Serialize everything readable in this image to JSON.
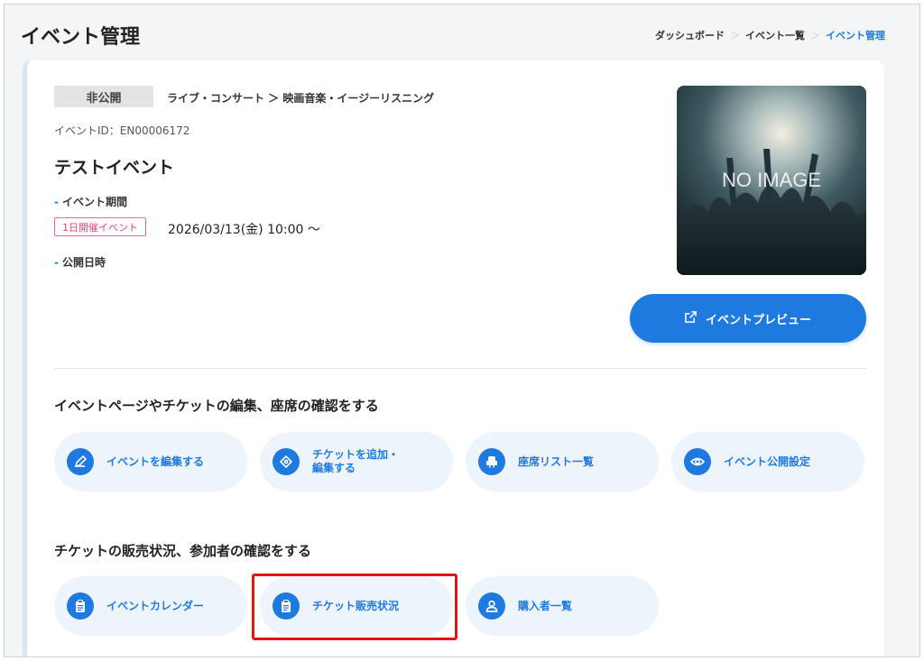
{
  "header": {
    "title": "イベント管理",
    "breadcrumb": [
      "ダッシュボード",
      "イベント一覧",
      "イベント管理"
    ]
  },
  "event": {
    "status": "非公開",
    "category": "ライブ・コンサート ＞ 映画音楽・イージーリスニング",
    "id_label": "イベントID：EN00006172",
    "name": "テストイベント",
    "period_label": "イベント期間",
    "one_day_tag": "1日開催イベント",
    "date": "2026/03/13(金) 10:00 ～",
    "publish_label": "公開日時",
    "image_text": "NO IMAGE"
  },
  "preview_button": {
    "label": "イベントプレビュー",
    "icon": "external-link-icon"
  },
  "section_edit": {
    "heading": "イベントページやチケットの編集、座席の確認をする",
    "actions": [
      {
        "label": "イベントを編集する",
        "icon": "pencil-icon"
      },
      {
        "label": "チケットを追加・\n編集する",
        "icon": "ticket-icon"
      },
      {
        "label": "座席リスト一覧",
        "icon": "seat-icon"
      },
      {
        "label": "イベント公開設定",
        "icon": "eye-icon"
      }
    ]
  },
  "section_sales": {
    "heading": "チケットの販売状況、参加者の確認をする",
    "actions": [
      {
        "label": "イベントカレンダー",
        "icon": "clipboard-icon"
      },
      {
        "label": "チケット販売状況",
        "icon": "clipboard-icon"
      },
      {
        "label": "購入者一覧",
        "icon": "user-icon"
      }
    ]
  },
  "colors": {
    "accent": "#1f7ae0",
    "action_bg": "#eef4fc",
    "highlight": "#e01515",
    "tag": "#e0457f"
  }
}
